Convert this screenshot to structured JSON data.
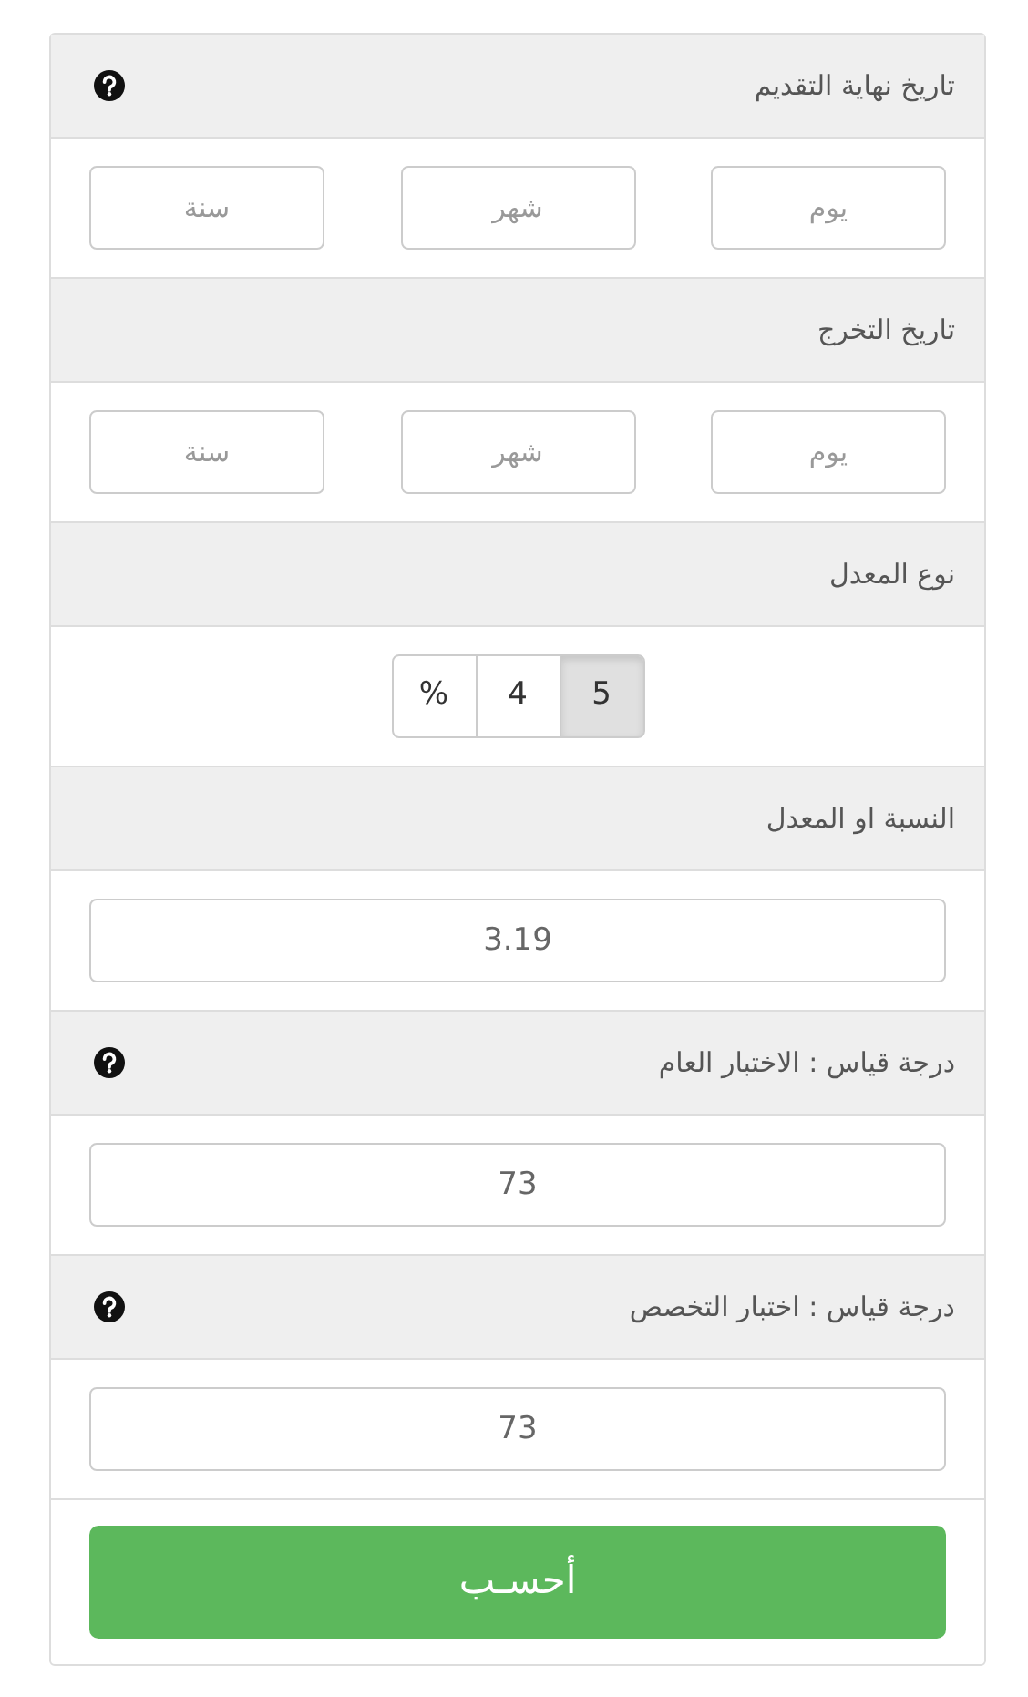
{
  "sections": [
    {
      "kind": "date",
      "label": "تاريخ نهاية التقديم",
      "help": true,
      "fields": [
        {
          "placeholder": "يوم"
        },
        {
          "placeholder": "شهر"
        },
        {
          "placeholder": "سنة"
        }
      ]
    },
    {
      "kind": "date",
      "label": "تاريخ التخرج",
      "help": false,
      "fields": [
        {
          "placeholder": "يوم"
        },
        {
          "placeholder": "شهر"
        },
        {
          "placeholder": "سنة"
        }
      ]
    },
    {
      "kind": "toggle",
      "label": "نوع المعدل",
      "help": false,
      "options": [
        {
          "label": "5",
          "selected": true
        },
        {
          "label": "4",
          "selected": false
        },
        {
          "label": "%",
          "selected": false
        }
      ]
    },
    {
      "kind": "input",
      "label": "النسبة او المعدل",
      "help": false,
      "value": "3.19"
    },
    {
      "kind": "input",
      "label": "درجة قياس : الاختبار العام",
      "help": true,
      "value": "73"
    },
    {
      "kind": "input",
      "label": "درجة قياس : اختبار التخصص",
      "help": true,
      "value": "73"
    }
  ],
  "submit": "أحسـب"
}
